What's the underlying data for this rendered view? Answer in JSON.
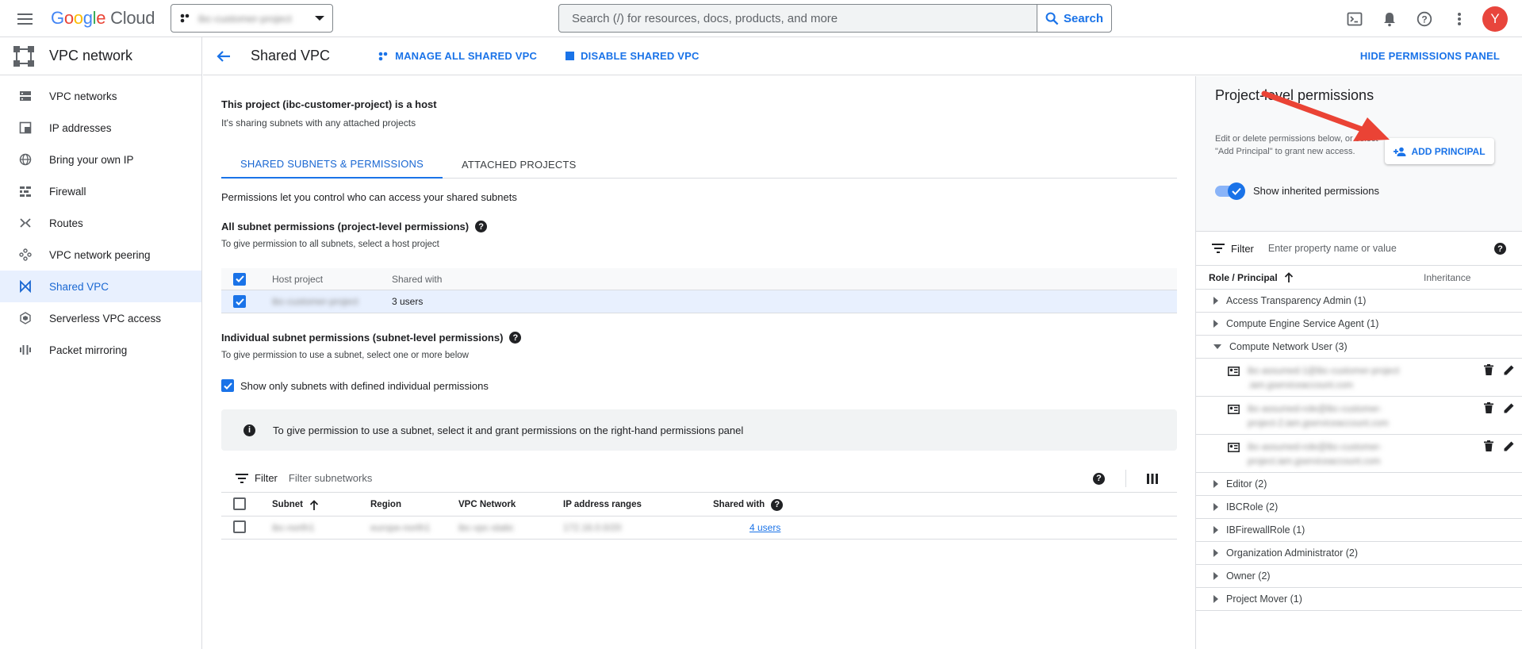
{
  "topbar": {
    "logo_letters": [
      "G",
      "o",
      "o",
      "g",
      "l",
      "e"
    ],
    "logo_suffix": "Cloud",
    "project_name": "ibc-customer-project",
    "search_placeholder": "Search (/) for resources, docs, products, and more",
    "search_button": "Search",
    "avatar_letter": "Y",
    "icons": [
      "terminal-icon",
      "bell-icon",
      "help-icon",
      "more-vert-icon"
    ]
  },
  "sidebar": {
    "title": "VPC network",
    "items": [
      {
        "label": "VPC networks",
        "icon": "vpc-networks-icon"
      },
      {
        "label": "IP addresses",
        "icon": "ip-addresses-icon"
      },
      {
        "label": "Bring your own IP",
        "icon": "globe-icon"
      },
      {
        "label": "Firewall",
        "icon": "firewall-icon"
      },
      {
        "label": "Routes",
        "icon": "routes-icon"
      },
      {
        "label": "VPC network peering",
        "icon": "peering-icon"
      },
      {
        "label": "Shared VPC",
        "icon": "shared-vpc-icon",
        "active": true
      },
      {
        "label": "Serverless VPC access",
        "icon": "serverless-icon"
      },
      {
        "label": "Packet mirroring",
        "icon": "packet-mirroring-icon"
      }
    ]
  },
  "header": {
    "title": "Shared VPC",
    "manage_all": "MANAGE ALL SHARED VPC",
    "disable": "DISABLE SHARED VPC",
    "hide_panel": "HIDE PERMISSIONS PANEL"
  },
  "main": {
    "host_title": "This project (ibc-customer-project) is a host",
    "host_sub": "It's sharing subnets with any attached projects",
    "tabs": [
      {
        "label": "SHARED SUBNETS & PERMISSIONS",
        "active": true
      },
      {
        "label": "ATTACHED PROJECTS",
        "active": false
      }
    ],
    "permissions_intro": "Permissions let you control who can access your shared subnets",
    "all_subnet_title": "All subnet permissions (project-level permissions)",
    "all_subnet_sub": "To give permission to all subnets, select a host project",
    "host_table": {
      "columns": [
        "Host project",
        "Shared with"
      ],
      "rows": [
        {
          "project": "ibc-customer-project",
          "shared_with": "3 users",
          "checked": true
        }
      ]
    },
    "individual_title": "Individual subnet permissions (subnet-level permissions)",
    "individual_sub": "To give permission to use a subnet, select one or more below",
    "show_only_label": "Show only subnets with defined individual permissions",
    "info_text": "To give permission to use a subnet, select it and grant permissions on the right-hand permissions panel",
    "filter_label": "Filter",
    "filter_placeholder": "Filter subnetworks",
    "subnet_table": {
      "columns": [
        "Subnet",
        "Region",
        "VPC Network",
        "IP address ranges",
        "Shared with"
      ],
      "rows": [
        {
          "subnet": "ibc-north1",
          "region": "europe-north1",
          "network": "ibc-vpc-static",
          "range": "172.16.0.0/20",
          "shared_with": "4 users"
        }
      ]
    }
  },
  "permissions": {
    "title": "Project-level permissions",
    "description": "Edit or delete permissions below, or select \"Add Principal\" to grant new access.",
    "add_principal": "ADD PRINCIPAL",
    "show_inherited": "Show inherited permissions",
    "filter_label": "Filter",
    "filter_placeholder": "Enter property name or value",
    "col_role": "Role / Principal",
    "col_inheritance": "Inheritance",
    "roles": [
      {
        "label": "Access Transparency Admin (1)",
        "expanded": false
      },
      {
        "label": "Compute Engine Service Agent (1)",
        "expanded": false
      },
      {
        "label": "Compute Network User (3)",
        "expanded": true
      }
    ],
    "members": [
      {
        "line1": "ibc-assumed-1@ibc-customer-project",
        "line2": ".iam.gserviceaccount.com"
      },
      {
        "line1": "ibc-assumed-role@ibc-customer-",
        "line2": "project-2.iam.gserviceaccount.com"
      },
      {
        "line1": "ibc-assumed-role@ibc-customer-",
        "line2": "project.iam.gserviceaccount.com"
      }
    ],
    "roles_after": [
      {
        "label": "Editor (2)"
      },
      {
        "label": "IBCRole (2)"
      },
      {
        "label": "IBFirewallRole (1)"
      },
      {
        "label": "Organization Administrator (2)"
      },
      {
        "label": "Owner (2)"
      },
      {
        "label": "Project Mover (1)"
      }
    ]
  },
  "colors": {
    "accent": "#1a73e8",
    "annotation_arrow": "#ea4335"
  }
}
